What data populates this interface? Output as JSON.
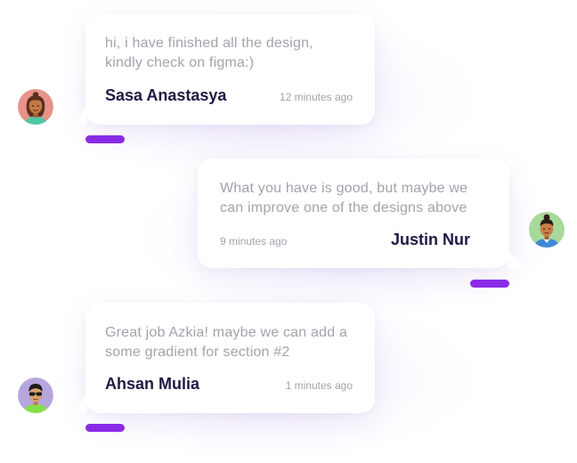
{
  "messages": [
    {
      "text": "hi, i have finished all the design,\nkindly check on figma:)",
      "sender": "Sasa Anastasya",
      "time": "12 minutes ago",
      "avatar_icon": "woman-avatar-icon",
      "side": "left"
    },
    {
      "text": "What you have is good, but maybe we\ncan improve one of the designs above",
      "sender": "Justin Nur",
      "time": "9 minutes ago",
      "avatar_icon": "man-avatar-icon",
      "side": "right"
    },
    {
      "text": "Great job Azkia! maybe we can add a\nsome gradient for section #2",
      "sender": "Ahsan Mulia",
      "time": "1 minutes ago",
      "avatar_icon": "man-with-sunglasses-avatar-icon",
      "side": "left"
    }
  ],
  "colors": {
    "accent": "#8a2be8",
    "name_text": "#1e1b44",
    "body_text": "#a3a3ac",
    "bubble_bg": "#ffffff"
  }
}
